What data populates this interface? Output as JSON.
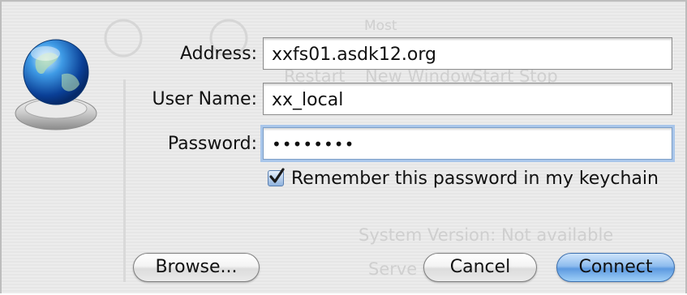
{
  "dialog": {
    "fields": {
      "address": {
        "label": "Address:",
        "value": "xxfs01.asdk12.org"
      },
      "username": {
        "label": "User Name:",
        "value": "xx_local"
      },
      "password": {
        "label": "Password:",
        "value": "••••••••"
      }
    },
    "remember_checkbox": {
      "label": "Remember this password in my keychain",
      "checked": true
    },
    "buttons": {
      "browse": "Browse...",
      "cancel": "Cancel",
      "connect": "Connect"
    }
  },
  "background_window": {
    "toolbar_labels": [
      "Restart",
      "New Window",
      "Start Stop"
    ],
    "ghost_word": "Most",
    "system_version": "System Version:  Not available",
    "server_partial": "Serve"
  },
  "icons": {
    "server_icon": "network-globe-icon",
    "checkbox_icon": "checkmark-icon"
  },
  "colors": {
    "focus_ring": "#a9c6ea",
    "default_button": "#5d9ae0"
  }
}
